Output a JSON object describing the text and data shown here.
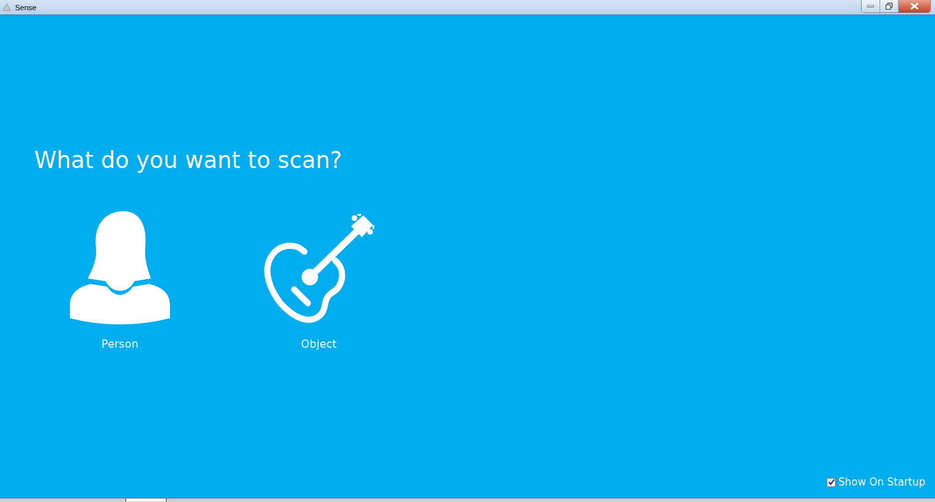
{
  "window": {
    "title": "Sense"
  },
  "heading": "What do you want to scan?",
  "choices": [
    {
      "kind": "person",
      "label": "Person"
    },
    {
      "kind": "object",
      "label": "Object"
    }
  ],
  "show_on_startup": {
    "label": "Show On Startup",
    "checked": true
  }
}
